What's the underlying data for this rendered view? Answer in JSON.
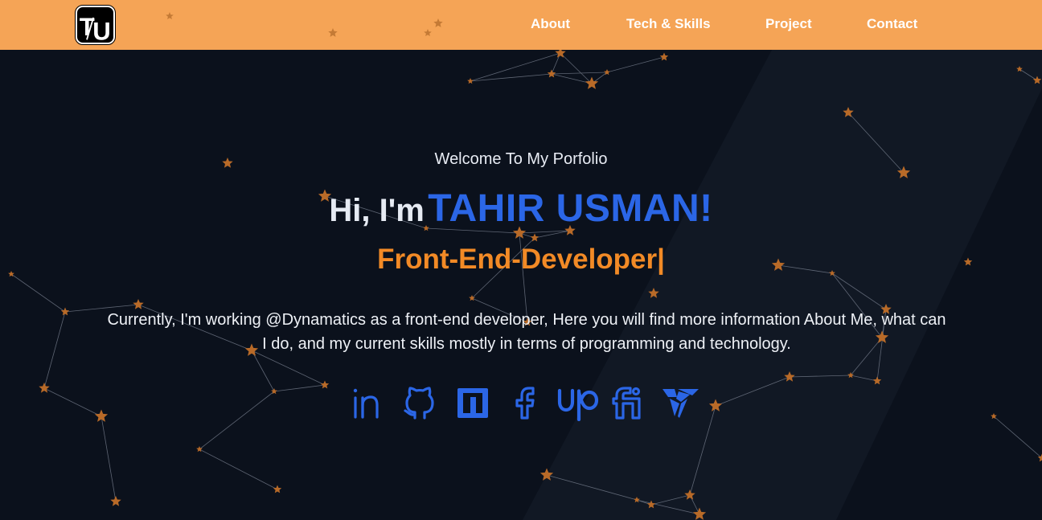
{
  "navbar": {
    "logo_text": "TU",
    "links": [
      "About",
      "Tech & Skills",
      "Project",
      "Contact"
    ]
  },
  "hero": {
    "welcome": "Welcome To My Porfolio",
    "greeting_prefix": "Hi, I'm",
    "name": "TAHIR USMAN!",
    "role": "Front-End-Developer|",
    "intro": "Currently, I'm working @Dynamatics as a front-end developer, Here you will find more information About Me, what can I do, and my current skills mostly in terms of programming and technology."
  },
  "socials": [
    {
      "icon": "linkedin-icon"
    },
    {
      "icon": "github-icon"
    },
    {
      "icon": "codepen-icon"
    },
    {
      "icon": "facebook-icon"
    },
    {
      "icon": "upwork-icon"
    },
    {
      "icon": "fiverr-icon"
    },
    {
      "icon": "freelancer-icon"
    }
  ],
  "colors": {
    "navbar": "#f5a456",
    "background": "#0b111c",
    "accent_blue": "#2b66e6",
    "accent_orange": "#f28a26",
    "star": "#b86a28"
  }
}
